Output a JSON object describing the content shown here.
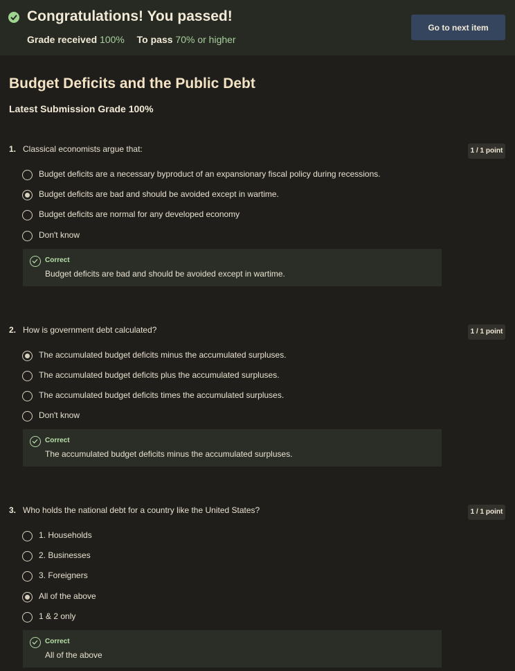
{
  "banner": {
    "title": "Congratulations! You passed!",
    "grade_label": "Grade received",
    "grade_value": "100%",
    "pass_label": "To pass",
    "pass_value": "70% or higher",
    "next_button": "Go to next item"
  },
  "quiz": {
    "title": "Budget Deficits and the Public Debt",
    "latest_grade": "Latest Submission Grade 100%"
  },
  "questions": [
    {
      "number": "1.",
      "text": "Classical economists argue that:",
      "points": "1 / 1 point",
      "options": [
        {
          "label": "Budget deficits are a necessary byproduct of an expansionary fiscal policy during recessions.",
          "selected": false
        },
        {
          "label": "Budget deficits are bad and should be avoided except in wartime.",
          "selected": true
        },
        {
          "label": "Budget deficits are normal for any developed economy",
          "selected": false
        },
        {
          "label": "Don't know",
          "selected": false
        }
      ],
      "feedback": {
        "status": "Correct",
        "answer": "Budget deficits are bad and should be avoided except in wartime."
      }
    },
    {
      "number": "2.",
      "text": "How is government debt calculated?",
      "points": "1 / 1 point",
      "options": [
        {
          "label": "The accumulated budget deficits minus the accumulated surpluses.",
          "selected": true
        },
        {
          "label": "The accumulated budget deficits plus the accumulated surpluses.",
          "selected": false
        },
        {
          "label": "The accumulated budget deficits times the accumulated surpluses.",
          "selected": false
        },
        {
          "label": "Don't know",
          "selected": false
        }
      ],
      "feedback": {
        "status": "Correct",
        "answer": "The accumulated budget deficits minus the accumulated surpluses."
      }
    },
    {
      "number": "3.",
      "text": "Who holds the national debt for a country like the United States?",
      "points": "1 / 1 point",
      "options": [
        {
          "label": "1. Households",
          "selected": false
        },
        {
          "label": "2. Businesses",
          "selected": false
        },
        {
          "label": "3. Foreigners",
          "selected": false
        },
        {
          "label": "All of the above",
          "selected": true
        },
        {
          "label": "1 & 2 only",
          "selected": false
        }
      ],
      "feedback": {
        "status": "Correct",
        "answer": "All of the above"
      }
    }
  ],
  "colors": {
    "background": "#1f1e1b",
    "banner": "#262a23",
    "accent_green": "#9fd48e",
    "button": "#35455e"
  },
  "icons": [
    "check-circle-icon",
    "check-outline-icon",
    "radio-icon"
  ]
}
